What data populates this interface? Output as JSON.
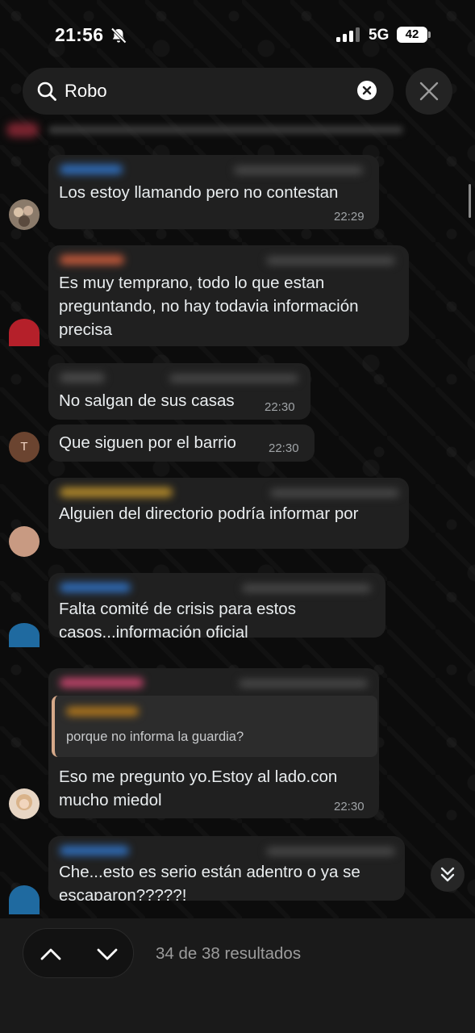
{
  "status_bar": {
    "time": "21:56",
    "network": "5G",
    "battery": "42"
  },
  "search": {
    "query": "Robo"
  },
  "messages": [
    {
      "text": "Los estoy llamando pero no contestan",
      "time": "22:29"
    },
    {
      "text": "Es muy temprano, todo lo que estan\npreguntando, no hay todavia información\nprecisa"
    },
    {
      "text": "No salgan de sus casas",
      "time": "22:30"
    },
    {
      "text": "Que siguen por el barrio",
      "time": "22:30",
      "avatar_letter": "T"
    },
    {
      "text": "Alguien del directorio podría informar por"
    },
    {
      "text": "Falta comité de crisis para estos\ncasos...información oficial"
    },
    {
      "quote": "porque no informa la guardia?",
      "text": "Eso me pregunto yo.Estoy al lado.con\nmucho miedol",
      "time": "22:30"
    },
    {
      "text": "Che...esto es serio están adentro o ya se\nescaparon?????!"
    }
  ],
  "search_nav": {
    "results": "34 de 38 resultados"
  },
  "colors": {
    "bubble": "#202020",
    "background": "#0c0c0c",
    "bottom_bar": "#1a1a1a"
  }
}
